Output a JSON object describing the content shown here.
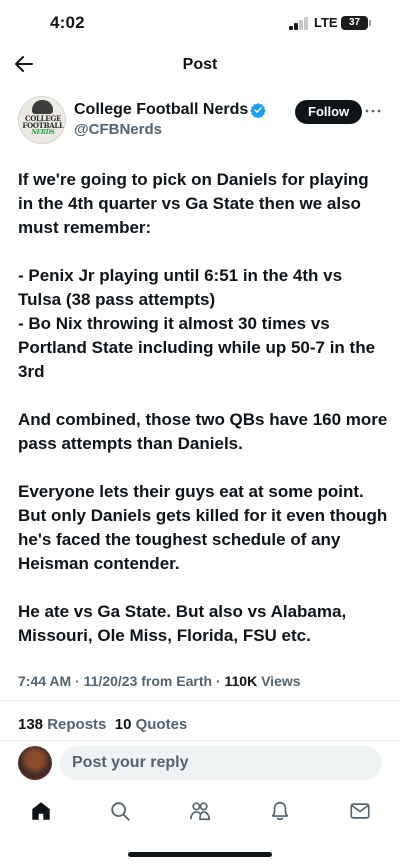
{
  "status_bar": {
    "time": "4:02",
    "network": "LTE",
    "battery": "37"
  },
  "header": {
    "back_icon": "arrow-left-icon",
    "title": "Post"
  },
  "author": {
    "display_name": "College Football Nerds",
    "handle": "@CFBNerds",
    "verified": true,
    "avatar_logo": [
      "COLLEGE",
      "FOOTBALL",
      "NERDS"
    ],
    "follow_label": "Follow",
    "more_icon": "ellipsis-icon"
  },
  "tweet": {
    "paragraphs": [
      [
        "If we're going to pick on Daniels for playing in the 4th quarter vs Ga State then we also must remember:"
      ],
      [
        "- Penix Jr playing until 6:51 in the 4th vs Tulsa (38 pass attempts)",
        "- Bo Nix throwing it almost 30 times vs Portland State including while up 50-7 in the 3rd"
      ],
      [
        "And combined, those two QBs have 160 more pass attempts than Daniels."
      ],
      [
        "Everyone lets their guys eat at some point. But only Daniels gets killed for it even though he's faced the toughest schedule of any Heisman contender."
      ],
      [
        "He ate vs Ga State. But also vs Alabama, Missouri, Ole Miss, Florida, FSU etc."
      ]
    ]
  },
  "meta": {
    "time": "7:44 AM",
    "date": "11/20/23",
    "source": "from Earth",
    "views_count": "110K",
    "views_label": "Views"
  },
  "stats": {
    "reposts_count": "138",
    "reposts_label": "Reposts",
    "quotes_count": "10",
    "quotes_label": "Quotes"
  },
  "reply": {
    "placeholder": "Post your reply"
  },
  "tabbar": {
    "items": [
      "home-icon",
      "search-icon",
      "communities-icon",
      "notifications-icon",
      "messages-icon"
    ]
  },
  "colors": {
    "text": "#0f1419",
    "secondary": "#536471",
    "verified": "#1d9bf0",
    "divider": "#eff3f4"
  }
}
